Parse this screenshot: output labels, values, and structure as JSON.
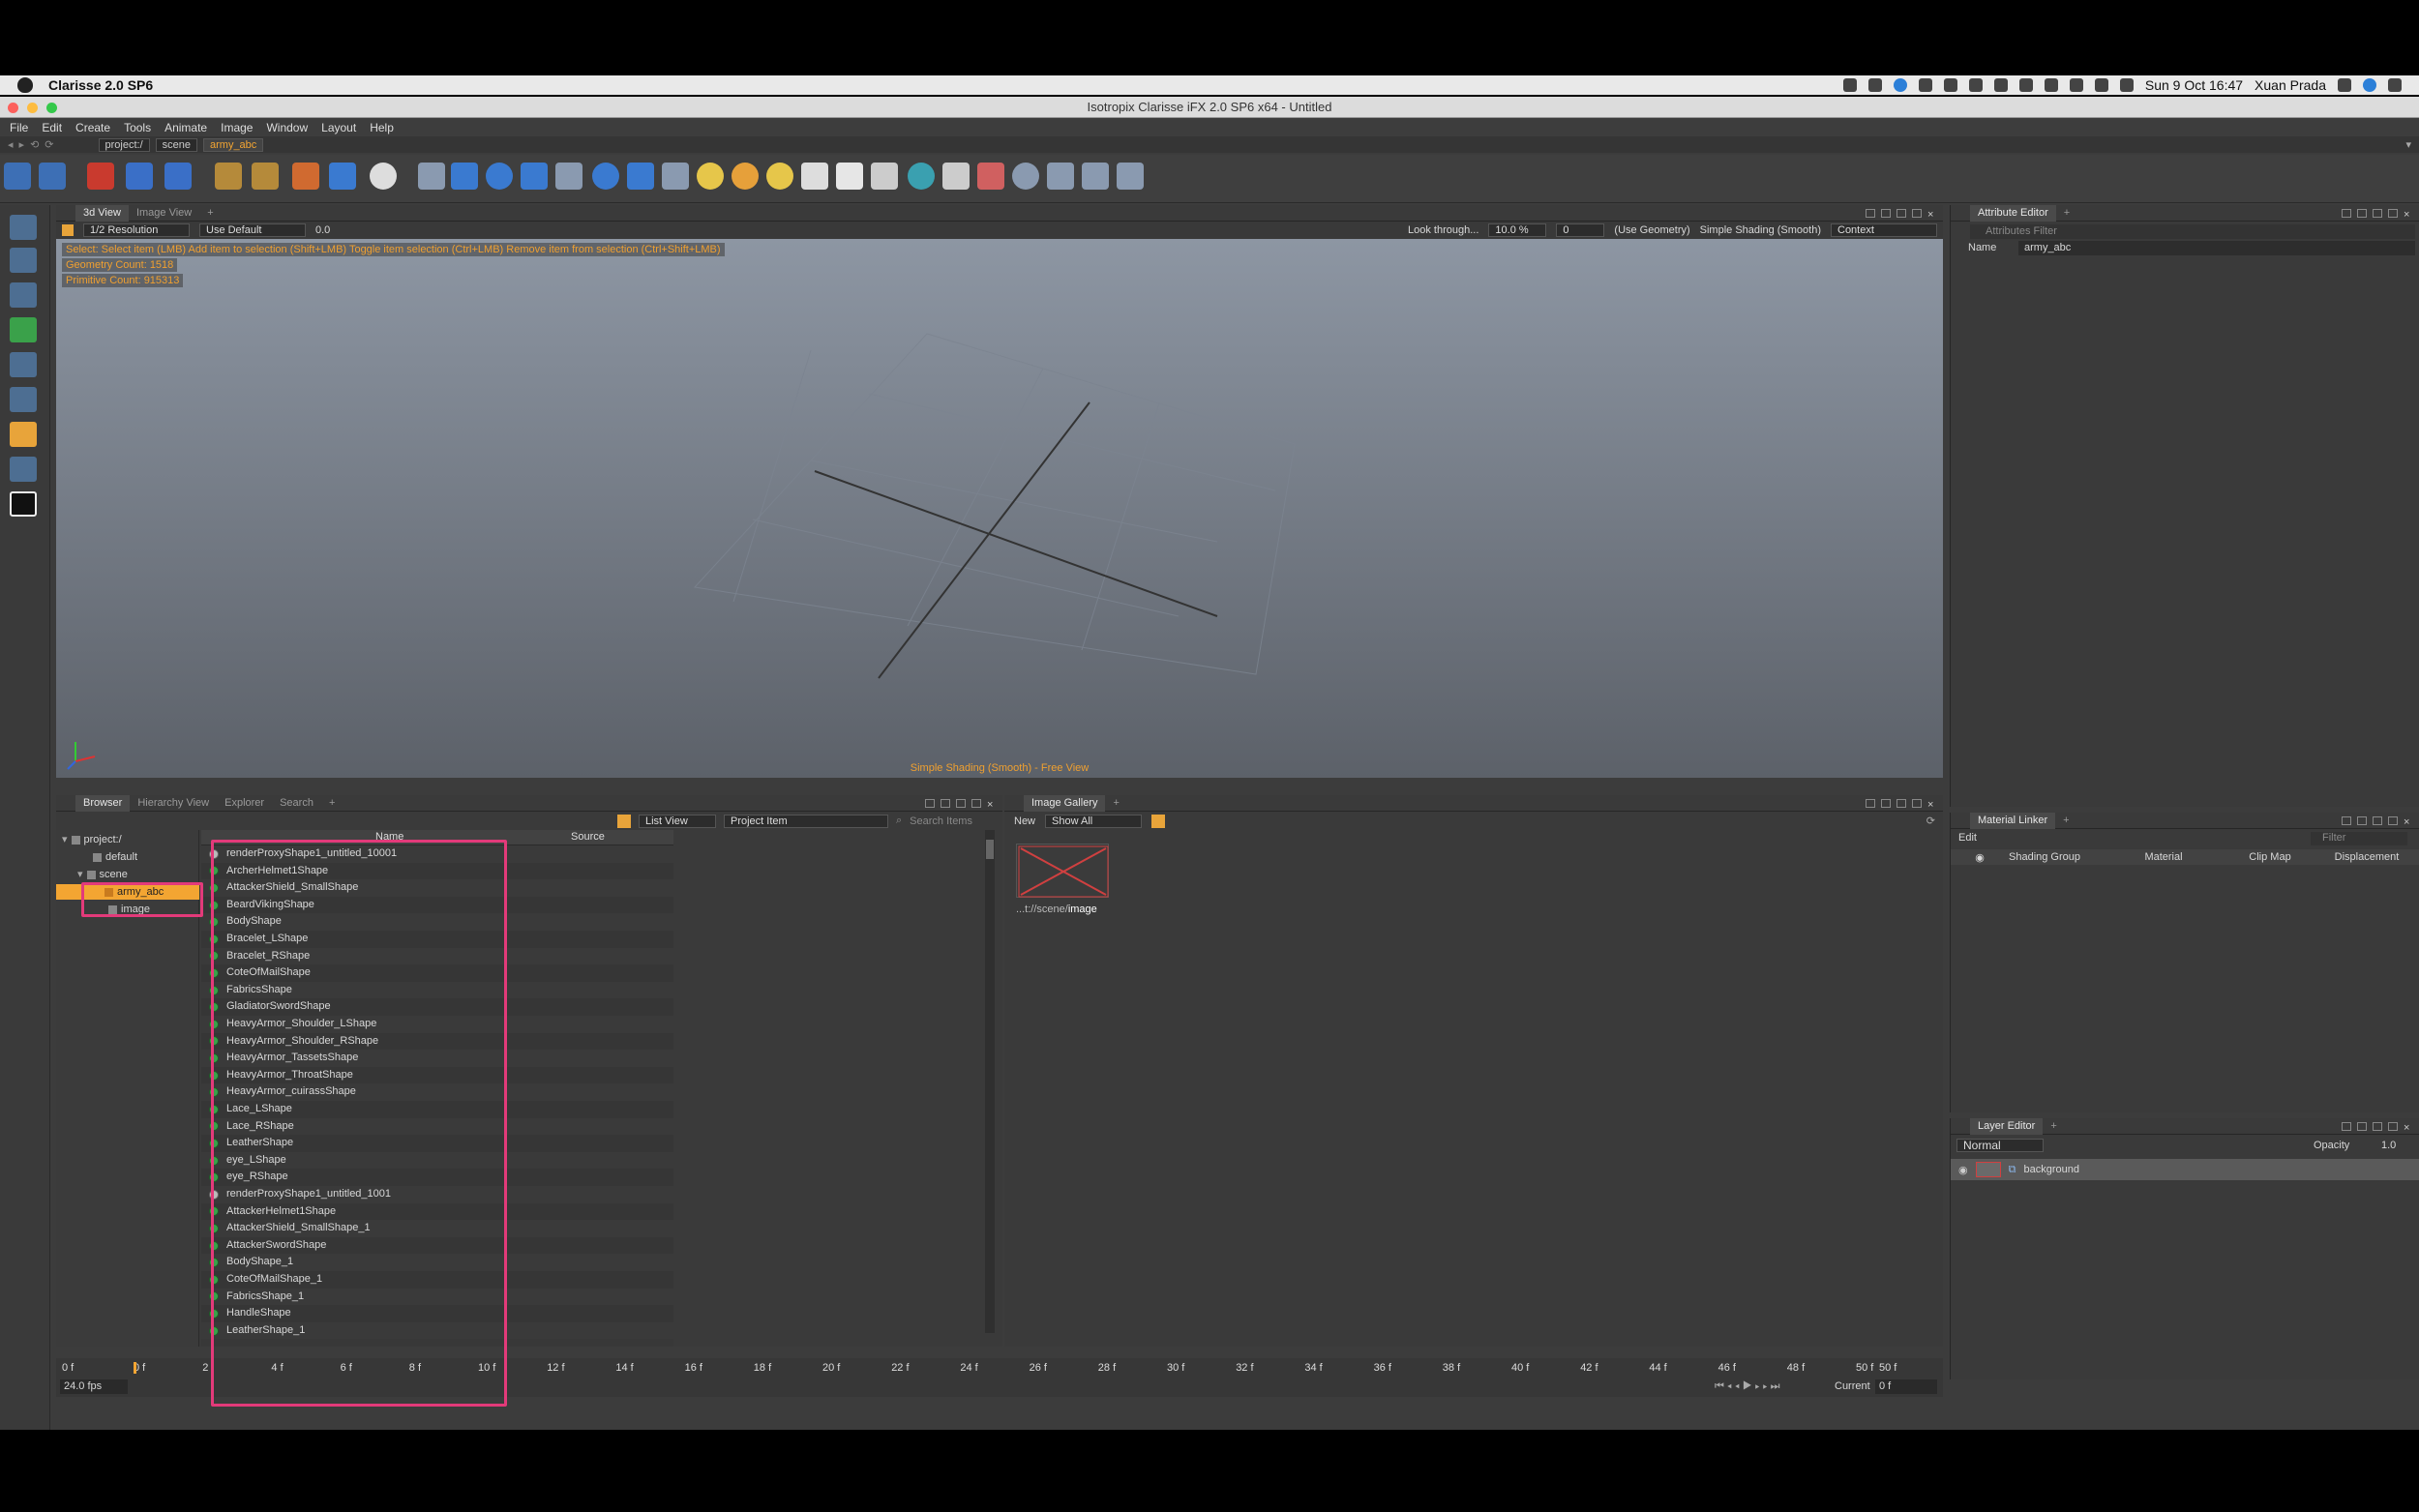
{
  "macbar": {
    "app_name": "Clarisse 2.0 SP6",
    "clock": "Sun 9 Oct  16:47",
    "user": "Xuan Prada"
  },
  "window": {
    "title": "Isotropix Clarisse iFX 2.0 SP6 x64  - Untitled"
  },
  "menu": [
    "File",
    "Edit",
    "Create",
    "Tools",
    "Animate",
    "Image",
    "Window",
    "Layout",
    "Help"
  ],
  "path": [
    "project:/",
    "scene",
    "army_abc"
  ],
  "viewport": {
    "tabs": [
      "3d View",
      "Image View"
    ],
    "resolution": "1/2 Resolution",
    "use_default": "Use Default",
    "value": "0.0",
    "look_through": "Look through...",
    "zoom": "10.0 %",
    "zoom2": "0",
    "geometry": "(Use Geometry)",
    "shading": "Simple Shading (Smooth)",
    "context": "Context",
    "hint": "Select: Select item (LMB)  Add item to selection (Shift+LMB)  Toggle item selection (Ctrl+LMB)  Remove item from selection (Ctrl+Shift+LMB)",
    "geometry_count": "Geometry Count: 1518",
    "primitive_count": "Primitive Count: 915313",
    "footer": "Simple Shading (Smooth) - Free View"
  },
  "browser": {
    "tabs": [
      "Browser",
      "Hierarchy View",
      "Explorer",
      "Search"
    ],
    "list_view": "List View",
    "project_item": "Project Item",
    "search_placeholder": "Search Items",
    "col_name": "Name",
    "col_source": "Source",
    "tree": [
      "project:/",
      "default",
      "scene",
      "army_abc",
      "image"
    ],
    "items": [
      "renderProxyShape1_untitled_10001",
      "ArcherHelmet1Shape",
      "AttackerShield_SmallShape",
      "BeardVikingShape",
      "BodyShape",
      "Bracelet_LShape",
      "Bracelet_RShape",
      "CoteOfMailShape",
      "FabricsShape",
      "GladiatorSwordShape",
      "HeavyArmor_Shoulder_LShape",
      "HeavyArmor_Shoulder_RShape",
      "HeavyArmor_TassetsShape",
      "HeavyArmor_ThroatShape",
      "HeavyArmor_cuirassShape",
      "Lace_LShape",
      "Lace_RShape",
      "LeatherShape",
      "eye_LShape",
      "eye_RShape",
      "renderProxyShape1_untitled_1001",
      "AttackerHelmet1Shape",
      "AttackerShield_SmallShape_1",
      "AttackerSwordShape",
      "BodyShape_1",
      "CoteOfMailShape_1",
      "FabricsShape_1",
      "HandleShape",
      "LeatherShape_1"
    ],
    "proxy_indexes": [
      0,
      20
    ]
  },
  "gallery": {
    "tab": "Image Gallery",
    "new": "New",
    "show": "Show All",
    "caption_prefix": "...t://scene/",
    "caption_name": "image"
  },
  "attribute_editor": {
    "tab": "Attribute Editor",
    "filter": "Attributes Filter",
    "name_label": "Name",
    "name_value": "army_abc"
  },
  "material_linker": {
    "tab": "Material Linker",
    "edit": "Edit",
    "filter": "Filter",
    "cols": [
      "Shading Group",
      "Material",
      "Clip Map",
      "Displacement"
    ]
  },
  "layer_editor": {
    "tab": "Layer Editor",
    "blend": "Normal",
    "opacity_label": "Opacity",
    "opacity": "1.0",
    "layer": "background"
  },
  "timeline": {
    "start": "0 f",
    "end": "50 f",
    "fps": "24.0 fps",
    "current_label": "Current",
    "current": "0 f",
    "ticks": [
      "0 f",
      "2",
      "4 f",
      "6 f",
      "8 f",
      "10 f",
      "12 f",
      "14 f",
      "16 f",
      "18 f",
      "20 f",
      "22 f",
      "24 f",
      "26 f",
      "28 f",
      "30 f",
      "32 f",
      "34 f",
      "36 f",
      "38 f",
      "40 f",
      "42 f",
      "44 f",
      "46 f",
      "48 f",
      "50 f"
    ]
  },
  "colors": {
    "accent": "#f3a532",
    "annotation": "#e33a7a"
  }
}
